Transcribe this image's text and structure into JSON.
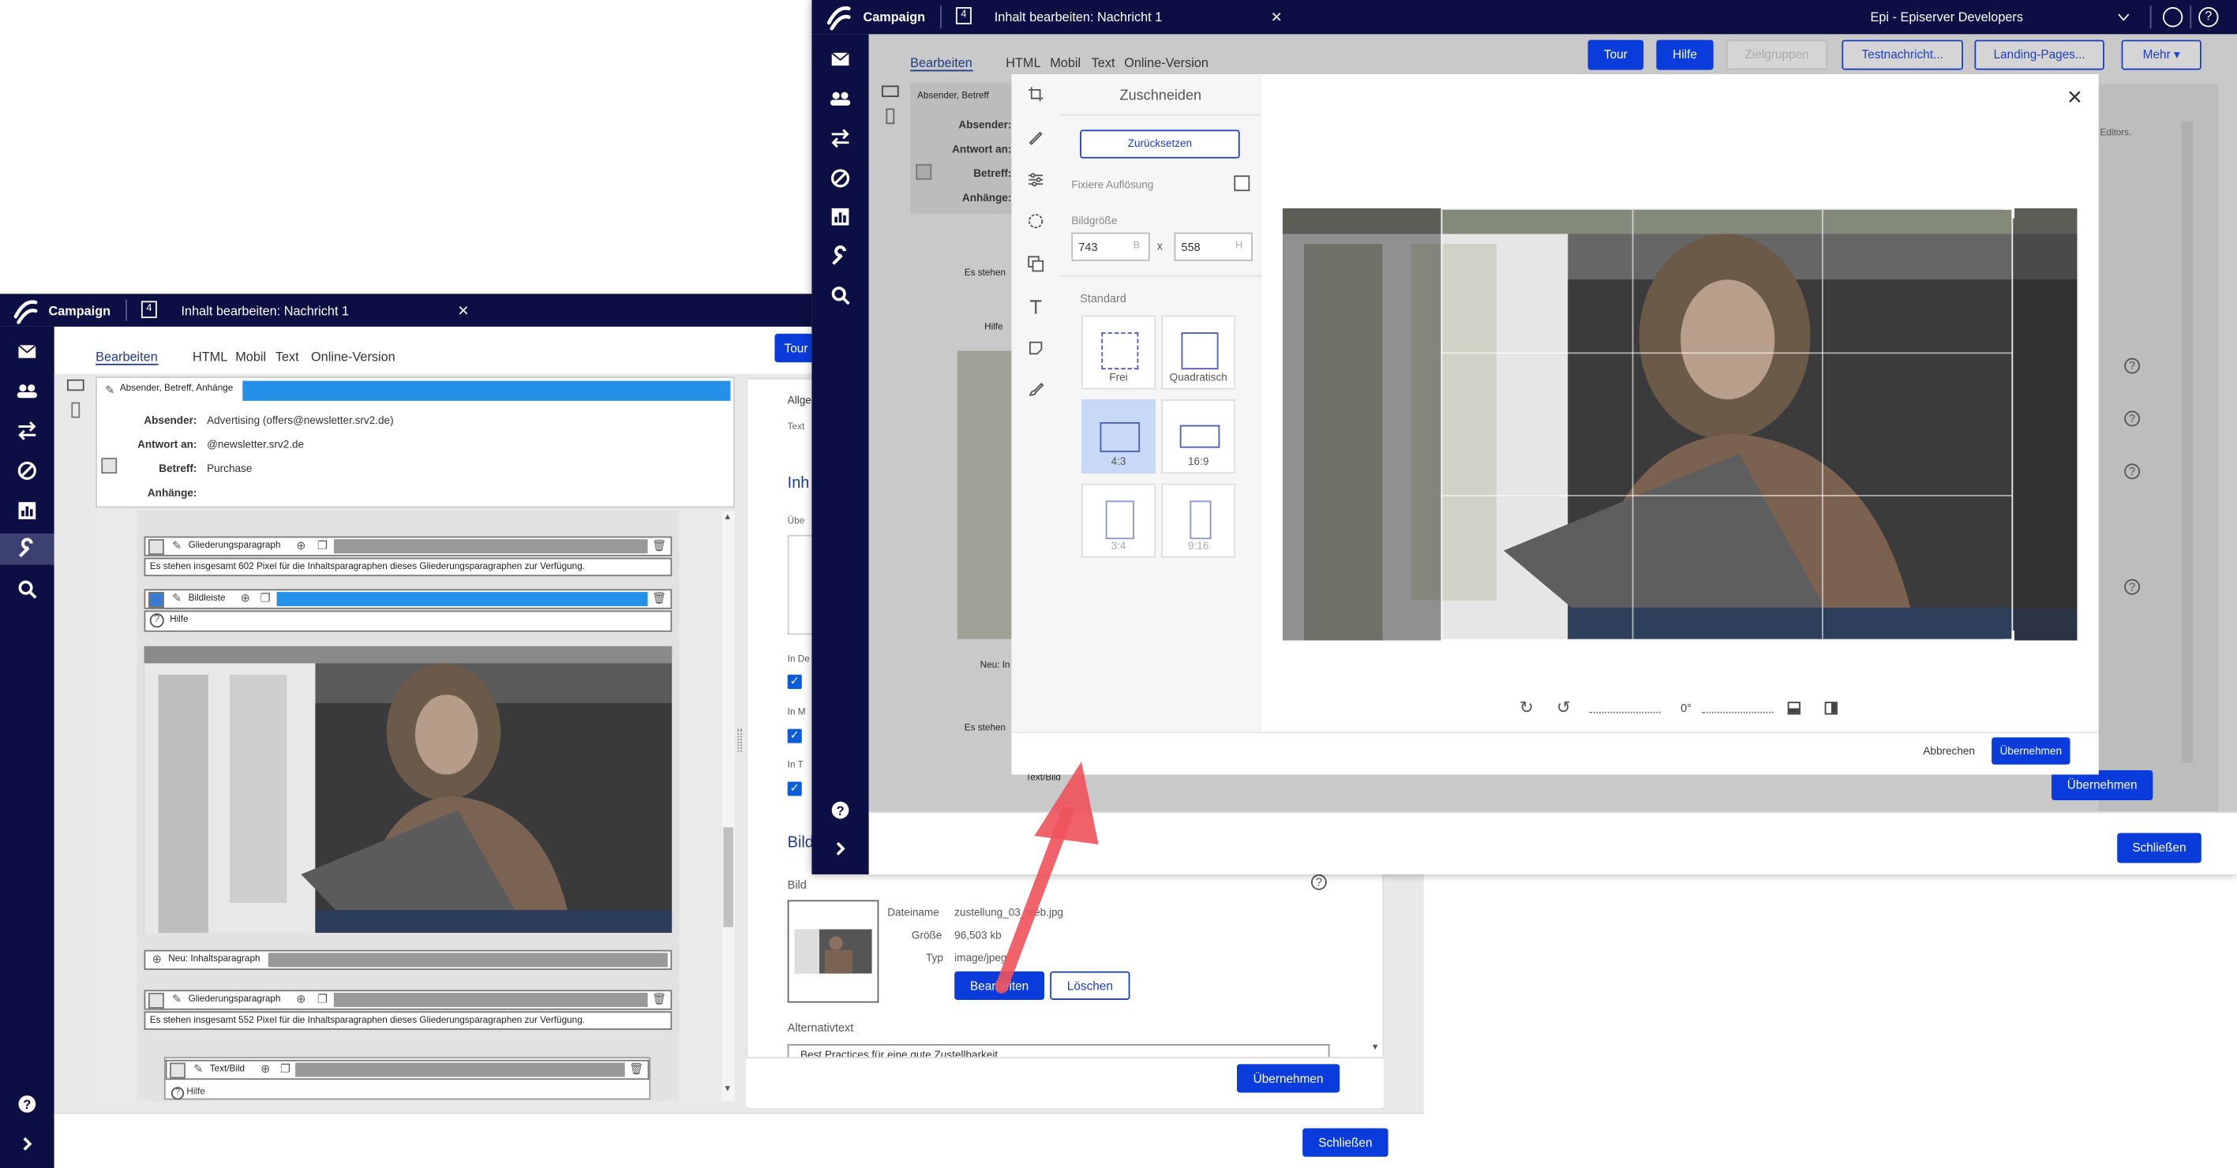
{
  "colors": {
    "nav": "#0b0f43",
    "primary": "#0a3cdc",
    "selection": "#2590e8",
    "arrow": "#f0525b"
  },
  "back_window": {
    "app_name": "Campaign",
    "tab_count": "4",
    "tab_title": "Inhalt bearbeiten: Nachricht 1",
    "close_icon": "×",
    "tabs": [
      "Bearbeiten",
      "HTML",
      "Mobil",
      "Text",
      "Online-Version"
    ],
    "tour_label": "Tour",
    "header_section": "Absender, Betreff, Anhänge",
    "fields": [
      {
        "label": "Absender:",
        "value": "Advertising (offers@newsletter.srv2.de)"
      },
      {
        "label": "Antwort an:",
        "value": "@newsletter.srv2.de"
      },
      {
        "label": "Betreff:",
        "value": "Purchase"
      },
      {
        "label": "Anhänge:",
        "value": ""
      }
    ],
    "paragraphs": {
      "outline1": "Gliederungsparagraph",
      "outline1_text": "Es stehen insgesamt 602 Pixel für die Inhaltsparagraphen dieses Gliederungsparagraphen zur Verfügung.",
      "image_bar": "Bildleiste",
      "help": "Hilfe",
      "new_para": "Neu: Inhaltsparagraph",
      "outline2": "Gliederungsparagraph",
      "outline2_text": "Es stehen insgesamt 552 Pixel für die Inhaltsparagraphen dieses Gliederungsparagraphen zur Verfügung.",
      "text_image": "Text/Bild",
      "help2": "Hilfe"
    },
    "right_panel": {
      "tab_partial": "Allge",
      "text_partial": "Text",
      "section_partial": "Inh",
      "above_partial": "Übe",
      "checks": [
        "In De",
        "In M",
        "In T"
      ],
      "bild_heading": "Bild",
      "bild_label": "Bild",
      "file_name_label": "Dateiname",
      "file_name": "zustellung_03_web.jpg",
      "size_label": "Größe",
      "size": "96,503 kb",
      "type_label": "Typ",
      "type": "image/jpeg",
      "edit_button": "Bearbeiten",
      "delete_button": "Löschen",
      "alt_label": "Alternativtext",
      "alt_value": "Best Practices für eine gute Zustellbarkeit",
      "apply_button": "Übernehmen"
    },
    "close_button": "Schließen"
  },
  "front_window": {
    "app_name": "Campaign",
    "tab_count": "4",
    "tab_title": "Inhalt bearbeiten: Nachricht 1",
    "close_icon": "×",
    "account": "Epi - Episerver Developers",
    "tabs": [
      "Bearbeiten",
      "HTML",
      "Mobil",
      "Text",
      "Online-Version"
    ],
    "toolbar": {
      "tour": "Tour",
      "help": "Hilfe",
      "target_groups": "Zielgruppen",
      "test_message": "Testnachricht...",
      "landing_pages": "Landing-Pages...",
      "more": "Mehr"
    },
    "header_section": "Absender, Betreff",
    "labels": [
      "Absender:",
      "Antwort an:",
      "Betreff:",
      "Anhänge:"
    ],
    "editors_partial": "Editors.",
    "bg_partial": {
      "es_stehen": "Es stehen",
      "hilfe": "Hilfe",
      "neu": "Neu: In",
      "text_bild": "Text/Bild"
    },
    "apply_button": "Übernehmen",
    "close_button": "Schließen"
  },
  "image_editor": {
    "panel_title": "Zuschneiden",
    "reset_button": "Zurücksetzen",
    "fixed_resolution_label": "Fixiere Auflösung",
    "size_label": "Bildgröße",
    "width_value": "743",
    "width_unit": "B",
    "height_value": "558",
    "height_unit": "H",
    "times": "x",
    "preset_label": "Standard",
    "ratios": [
      {
        "label": "Frei",
        "selected": false,
        "disabled": false
      },
      {
        "label": "Quadratisch",
        "selected": false,
        "disabled": false
      },
      {
        "label": "4:3",
        "selected": true,
        "disabled": false
      },
      {
        "label": "16:9",
        "selected": false,
        "disabled": false
      },
      {
        "label": "3:4",
        "selected": false,
        "disabled": true
      },
      {
        "label": "9:16",
        "selected": false,
        "disabled": true
      }
    ],
    "rotation_value": "0°",
    "cancel_button": "Abbrechen",
    "apply_button": "Übernehmen",
    "tools": [
      "crop-icon",
      "draw-icon",
      "adjust-icon",
      "shape-icon",
      "sticker-icon",
      "text-icon",
      "note-icon",
      "brush-icon"
    ]
  }
}
